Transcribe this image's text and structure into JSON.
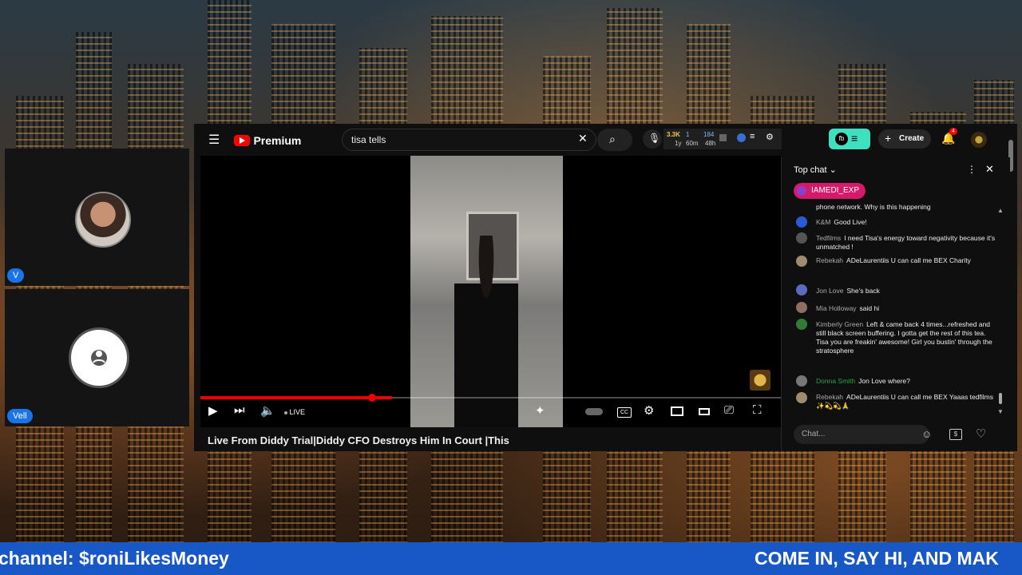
{
  "left_panel": {
    "users": [
      {
        "chip": "V"
      },
      {
        "chip": "Vell"
      }
    ]
  },
  "youtube": {
    "logo": "Premium",
    "search": {
      "value": "tisa tells"
    },
    "stats": {
      "views": "3.3K",
      "views_age": "1y",
      "likes": "1",
      "likes_age": "60m",
      "count3": "184",
      "count3_age": "48h"
    },
    "create_label": "Create",
    "notifications": "4",
    "player": {
      "live_label": "LIVE"
    },
    "video_title": "Live From Diddy Trial|Diddy CFO Destroys Him In Court |This"
  },
  "chat": {
    "header": "Top chat",
    "pinned": "IAMEDI_EXP",
    "messages": [
      {
        "author": "",
        "text": "phone network. Why is this happening"
      },
      {
        "author": "K&M",
        "text": "Good Live!"
      },
      {
        "author": "Tedfilms",
        "text": "I need Tisa's energy toward negativity because it's unmatched !"
      },
      {
        "author": "Rebekah",
        "text": "ADeLaurentiis U can call me BEX Charity"
      },
      {
        "author": "Jon Love",
        "text": "She's back"
      },
      {
        "author": "Mia Holloway",
        "text": "said hi"
      },
      {
        "author": "Kimberly Green",
        "text": "Left & came back 4 times...refreshed and still black screen buffering. I gotta get the rest of this tea. Tisa you are freakin' awesome! Girl you bustin' through the stratosphere"
      },
      {
        "author": "Donna Smith",
        "text": "Jon Love where?"
      },
      {
        "author": "Rebekah",
        "text": "ADeLaurentiis U can call me BEX Yaaas tedfilms ✨💫💫🙏"
      }
    ],
    "input_placeholder": "Chat..."
  },
  "banner": {
    "left": "channel: $roniLikesMoney",
    "right": "COME IN, SAY HI, AND MAK"
  },
  "colors": {
    "accent": "#1757c6",
    "youtube_red": "#ff0000",
    "pin": "#d51a6a"
  }
}
